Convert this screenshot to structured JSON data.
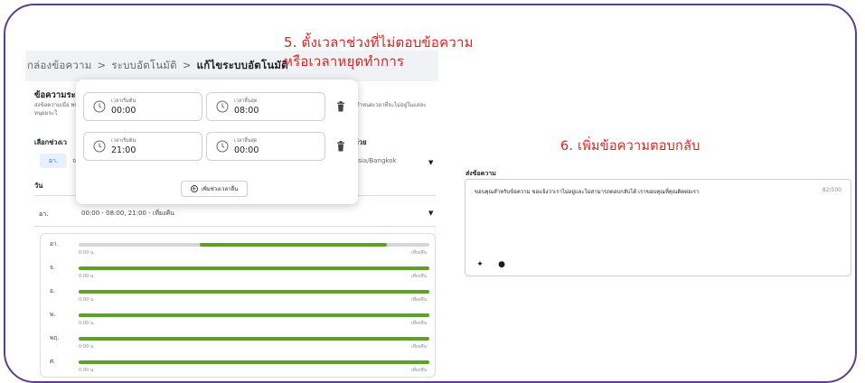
{
  "breadcrumb": {
    "items": [
      "กล่องข้อความ",
      "ระบบอัตโนมัติ",
      "แก้ไขระบบอัตโนมัติ"
    ],
    "separator": ">"
  },
  "annotations": {
    "step5_line1": "5. ตั้งเวลาช่วงที่ไม่ตอบข้อความ",
    "step5_line2": "หรือเวลาหยุดทำการ",
    "step6": "6. เพิ่มข้อความตอบกลับ",
    "color": "#e0201f"
  },
  "settings": {
    "section_title": "ข้อความระ",
    "section_desc": "ส่งข้อความเมื่อ พบ ม หนุผมจะใ",
    "section_desc_right": "กำหนดเวลาที่จะไม่อยู่ในแต่ละ",
    "schedule_label": "เลือกช่วงเว",
    "day_chip": "อา.",
    "day_chip_2": "จ",
    "timezone_label": "ด้วย",
    "timezone_value": "7) Asia/Bangkok",
    "day_column_label": "วัน",
    "day_row": {
      "day": "อา.",
      "value": "00:00 - 08:00, 21:00 - เที่ยงคืน"
    }
  },
  "popup": {
    "rows": [
      {
        "start_label": "เวลาเริ่มต้น",
        "start_value": "00:00",
        "end_label": "เวลาสิ้นสุด",
        "end_value": "08:00"
      },
      {
        "start_label": "เวลาเริ่มต้น",
        "start_value": "21:00",
        "end_label": "เวลาสิ้นสุด",
        "end_value": "00:00"
      }
    ],
    "add_button": "เพิ่มช่วงเวลาอื่น"
  },
  "timeline": {
    "start_label": "0:00 น.",
    "end_label": "เที่ยงคืน",
    "colors": {
      "track": "#d4d6d9",
      "active": "#5ba226"
    },
    "days": [
      {
        "day": "อา.",
        "segments": [
          [
            0,
            0.34
          ],
          [
            0.34,
            0.88
          ],
          [
            0.88,
            1.0
          ]
        ],
        "active": [
          false,
          true,
          false
        ]
      },
      {
        "day": "จ.",
        "segments": [
          [
            0,
            1.0
          ]
        ],
        "active": [
          true
        ]
      },
      {
        "day": "อ.",
        "segments": [
          [
            0,
            1.0
          ]
        ],
        "active": [
          true
        ]
      },
      {
        "day": "พ.",
        "segments": [
          [
            0,
            1.0
          ]
        ],
        "active": [
          true
        ]
      },
      {
        "day": "พฤ.",
        "segments": [
          [
            0,
            1.0
          ]
        ],
        "active": [
          true
        ]
      },
      {
        "day": "ศ.",
        "segments": [
          [
            0,
            1.0
          ]
        ],
        "active": [
          true
        ]
      }
    ]
  },
  "reply": {
    "label": "ส่งข้อความ",
    "text": "ขอบคุณสำหรับข้อความ ขอแจ้งว่าเราไม่อยู่และไม่สามารถตอบกลับได้ เราขอบคุณที่คุณติดต่อเรา",
    "count": "82/500",
    "tools": [
      "sparkle-icon",
      "emoji-icon"
    ]
  }
}
